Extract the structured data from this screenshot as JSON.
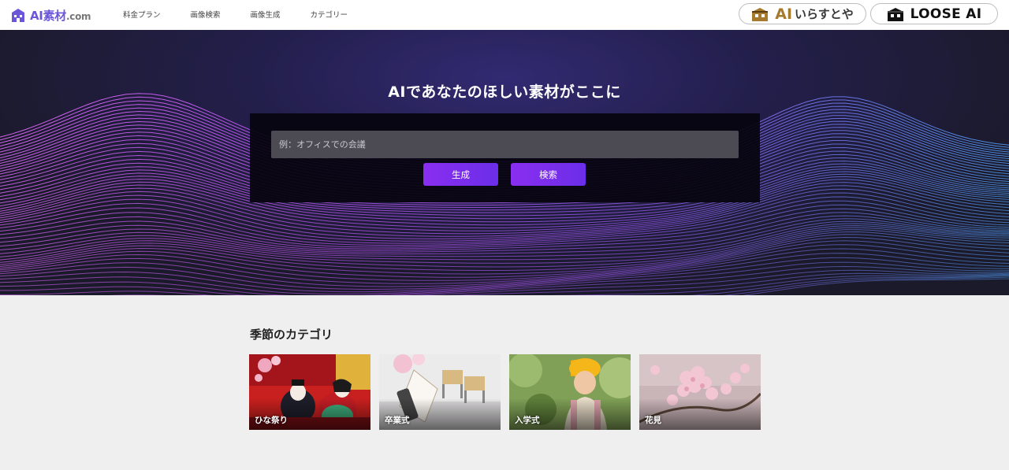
{
  "header": {
    "logo_main": "AI素材",
    "logo_suffix": ".com",
    "nav": [
      "料金プラン",
      "画像検索",
      "画像生成",
      "カテゴリー"
    ],
    "partner1": {
      "ai": "AI",
      "kana": "いらすとや"
    },
    "partner2": {
      "label": "LOOSE AI"
    }
  },
  "hero": {
    "title": "AIであなたのほしい素材がここに",
    "search_placeholder": "例：オフィスでの会議",
    "search_value": "",
    "generate_label": "生成",
    "search_label": "検索"
  },
  "seasonal": {
    "title": "季節のカテゴリ",
    "cards": [
      {
        "label": "ひな祭り",
        "icon": "hina-dolls-image"
      },
      {
        "label": "卒業式",
        "icon": "graduation-certificate-image"
      },
      {
        "label": "入学式",
        "icon": "school-child-image"
      },
      {
        "label": "花見",
        "icon": "cherry-blossom-image"
      }
    ]
  },
  "colors": {
    "brand": "#6b55d8",
    "button": "#8a2ef0",
    "wave_pink": "#c65cf0",
    "wave_blue": "#4a8fe0"
  }
}
